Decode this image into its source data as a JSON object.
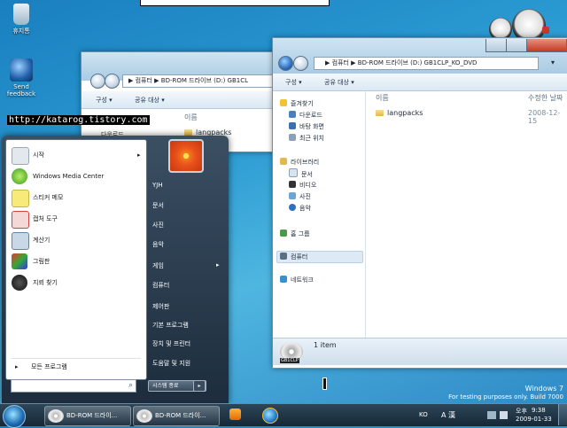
{
  "desktop": {
    "icons": [
      {
        "label": "휴지통"
      },
      {
        "label": "Send feedback"
      }
    ],
    "blog_url": "http://katarog.tistory.com",
    "watermark_line1": "Windows 7",
    "watermark_line2": "For testing purposes only. Build 7000"
  },
  "back_window": {
    "address": "▶ 컴퓨터 ▶ BD-ROM 드라이브 (D:) GB1CL",
    "toolbar": {
      "organize": "구성 ▾",
      "share": "공유 대상 ▾"
    },
    "column_name": "이름",
    "nav_partial": "다운로드",
    "file": "langpacks"
  },
  "front_window": {
    "address": "▶ 컴퓨터 ▶ BD-ROM 드라이브 (D:) GB1CLP_KO_DVD",
    "search_arrow": "▾",
    "toolbar": {
      "organize": "구성 ▾",
      "share": "공유 대상 ▾"
    },
    "columns": {
      "name": "이름",
      "date": "수정한 날짜"
    },
    "files": [
      {
        "name": "langpacks",
        "date": "2008-12-15"
      }
    ],
    "nav": {
      "favorites": "즐겨찾기",
      "downloads": "다운로드",
      "desktop": "바탕 화면",
      "recent": "최근 위치",
      "libraries": "라이브러리",
      "documents": "문서",
      "videos": "비디오",
      "pictures": "사진",
      "music": "음악",
      "homegroup": "홈 그룹",
      "computer": "컴퓨터",
      "network": "네트워크"
    },
    "status": "1 item",
    "drive_label": "GB1CLP"
  },
  "start_menu": {
    "programs": [
      {
        "label": "시작",
        "has_arrow": true
      },
      {
        "label": "Windows Media Center"
      },
      {
        "label": "스티커 메모"
      },
      {
        "label": "캡처 도구"
      },
      {
        "label": "계산기"
      },
      {
        "label": "그림판"
      },
      {
        "label": "지뢰 찾기"
      }
    ],
    "all_programs": "모든 프로그램",
    "right_items": [
      "YJH",
      "문서",
      "사진",
      "음악",
      "게임",
      "컴퓨터",
      "제어판",
      "기본 프로그램",
      "장치 및 프린터",
      "도움말 및 지원"
    ],
    "shutdown": "시스템 종료",
    "shutdown_arrow": "▸",
    "game_arrow": "▸",
    "search_icon": "⌕"
  },
  "taskbar": {
    "buttons": [
      {
        "label": "BD-ROM 드라이...",
        "drive": "GB1CLP"
      },
      {
        "label": "BD-ROM 드라이...",
        "drive": "GB1CLP"
      }
    ],
    "tray": {
      "lang": "KO",
      "ime": "A 漢",
      "ampm": "오후",
      "time": "9:38",
      "date": "2009-01-33"
    }
  },
  "colors": {
    "accent": "#2e6fbf",
    "taskbar": "#1d3244"
  }
}
